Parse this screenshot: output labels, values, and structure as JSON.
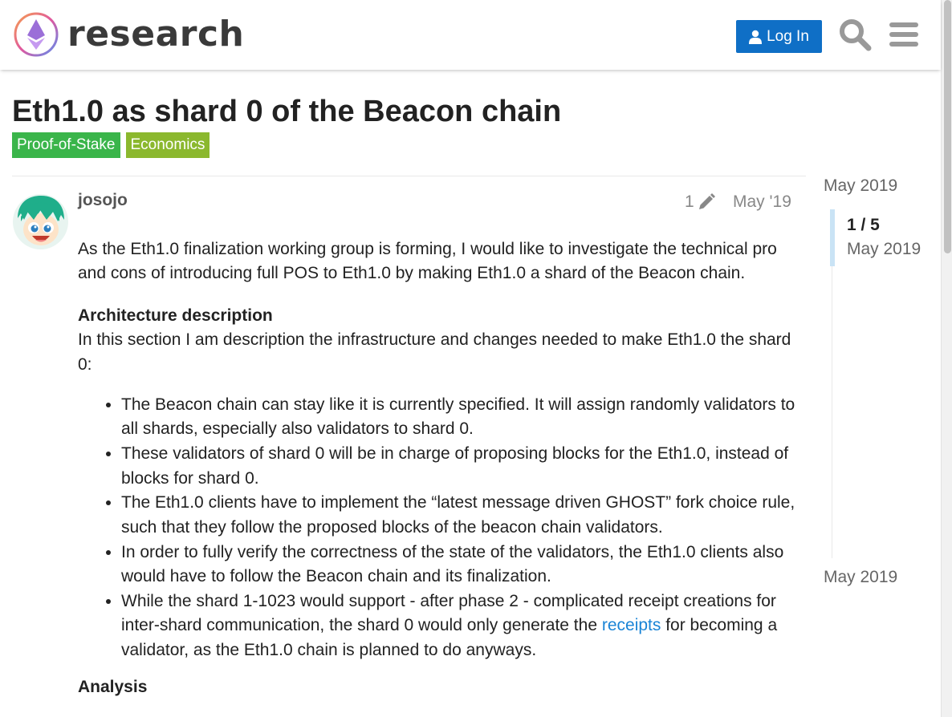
{
  "header": {
    "logo_text": "research",
    "login_label": "Log In",
    "brand_color": "#0f6fc6"
  },
  "topic": {
    "title": "Eth1.0 as shard 0 of the Beacon chain",
    "tags": [
      {
        "label": "Proof-of-Stake",
        "color": "#3ab54a"
      },
      {
        "label": "Economics",
        "color": "#8bb82e"
      }
    ]
  },
  "post": {
    "username": "josojo",
    "edit_count": "1",
    "date": "May '19",
    "intro": "As the Eth1.0 finalization working group is forming, I would like to investigate the technical pro and cons of introducing full POS to Eth1.0 by making Eth1.0 a shard of the Beacon chain.",
    "arch_heading": "Architecture description",
    "arch_text": "In this section I am description the infrastructure and changes needed to make Eth1.0 the shard 0:",
    "bullets": [
      "The Beacon chain can stay like it is currently specified. It will assign randomly validators to all shards, especially also validators to shard 0.",
      "These validators of shard 0 will be in charge of proposing blocks for the Eth1.0, instead of blocks for shard 0.",
      "The Eth1.0 clients have to implement the “latest message driven GHOST” fork choice rule, such that they follow the proposed blocks of the beacon chain validators.",
      "In order to fully verify the correctness of the state of the validators, the Eth1.0 clients also would have to follow the Beacon chain and its finalization."
    ],
    "last_bullet_before": "While the shard 1-1023 would support - after phase 2 - complicated receipt creations for inter-shard communication, the shard 0 would only generate the ",
    "last_bullet_link": "receipts",
    "last_bullet_after": " for becoming a validator, as the Eth1.0 chain is planned to do anyways.",
    "analysis_heading": "Analysis"
  },
  "timeline": {
    "start": "May 2019",
    "position": "1 / 5",
    "position_date": "May 2019",
    "end": "May 2019"
  }
}
